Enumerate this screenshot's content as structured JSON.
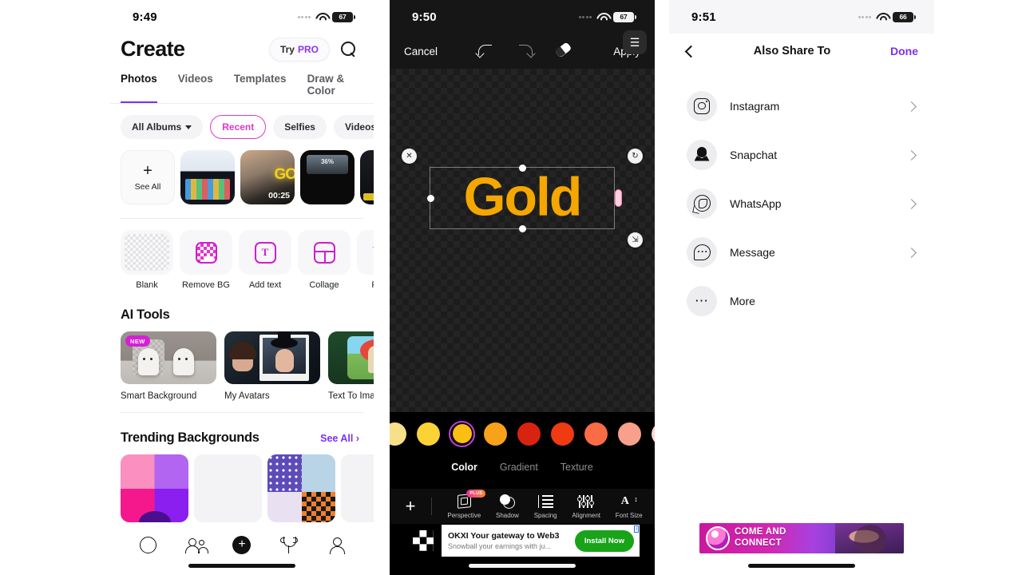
{
  "panel_create": {
    "status": {
      "time": "9:49",
      "battery": "67",
      "wifi_icon": "wifi-icon",
      "signal_icon": "signal-dots-icon"
    },
    "header": {
      "title": "Create",
      "try_pro_prefix": "Try",
      "try_pro_highlight": "PRO",
      "search_icon": "search-icon"
    },
    "tabs": [
      {
        "label": "Photos",
        "active": true
      },
      {
        "label": "Videos",
        "active": false
      },
      {
        "label": "Templates",
        "active": false
      },
      {
        "label": "Draw & Color",
        "active": false
      }
    ],
    "chips": [
      {
        "label": "All Albums",
        "selected": false,
        "has_caret": true
      },
      {
        "label": "Recent",
        "selected": true,
        "has_caret": false
      },
      {
        "label": "Selfies",
        "selected": false,
        "has_caret": false
      },
      {
        "label": "Videos",
        "selected": false,
        "has_caret": false
      }
    ],
    "see_all_tile": {
      "label": "See All",
      "icon": "plus-icon"
    },
    "thumbnails": [
      {
        "name": "screen-recording-thumb",
        "duration": ""
      },
      {
        "name": "skateboard-video-thumb",
        "duration": "00:25",
        "overlay_text": "GO"
      },
      {
        "name": "dark-export-thumb",
        "percent": "36%"
      },
      {
        "name": "timeline-thumb",
        "duration": ""
      }
    ],
    "quick_tools": [
      {
        "label": "Blank",
        "icon": "transparent-checker-icon"
      },
      {
        "label": "Remove BG",
        "icon": "remove-background-icon"
      },
      {
        "label": "Add text",
        "icon": "text-box-icon"
      },
      {
        "label": "Collage",
        "icon": "collage-grid-icon"
      },
      {
        "label": "Remo",
        "icon": "magic-wand-icon"
      }
    ],
    "ai_tools": {
      "title": "AI Tools",
      "cards": [
        {
          "label": "Smart Background",
          "badge": "NEW",
          "art": "ghost-photo"
        },
        {
          "label": "My Avatars",
          "badge": "",
          "art": "avatar-portraits"
        },
        {
          "label": "Text To Imag",
          "badge": "",
          "art": "text-to-image-art"
        }
      ]
    },
    "trending": {
      "title": "Trending Backgrounds",
      "see_all": "See All",
      "see_all_chevron": "chevron-right-icon",
      "items": [
        "pink-purple-gradient",
        "blank-light",
        "halloween-pattern",
        "light-tile"
      ]
    },
    "tabbar": [
      {
        "name": "discover",
        "icon": "compass-icon"
      },
      {
        "name": "community",
        "icon": "people-icon"
      },
      {
        "name": "create",
        "icon": "plus-circle-icon"
      },
      {
        "name": "challenges",
        "icon": "trophy-icon"
      },
      {
        "name": "profile",
        "icon": "person-icon"
      }
    ]
  },
  "panel_editor": {
    "status": {
      "time": "9:50",
      "battery": "67"
    },
    "topbar": {
      "cancel": "Cancel",
      "apply": "Apply",
      "undo_icon": "undo-icon",
      "redo_icon": "redo-icon",
      "eraser_icon": "eraser-icon"
    },
    "layers_icon": "layers-icon",
    "canvas": {
      "text_value": "Gold",
      "text_color": "#F5A700",
      "delete_icon": "close-icon",
      "rotate_icon": "rotate-icon",
      "resize_icon": "resize-icon",
      "edit_handle": "edit-pill-handle"
    },
    "swatches": [
      {
        "color": "#F6E08A",
        "selected": false
      },
      {
        "color": "#FBD335",
        "selected": false
      },
      {
        "color": "#FBBF14",
        "selected": true
      },
      {
        "color": "#F8A21A",
        "selected": false
      },
      {
        "color": "#D7230F",
        "selected": false
      },
      {
        "color": "#F03A11",
        "selected": false
      },
      {
        "color": "#F96C45",
        "selected": false
      },
      {
        "color": "#F8A08B",
        "selected": false
      },
      {
        "color": "#FAD9CF",
        "selected": false
      }
    ],
    "modes": [
      {
        "label": "Color",
        "active": true
      },
      {
        "label": "Gradient",
        "active": false
      },
      {
        "label": "Texture",
        "active": false
      }
    ],
    "toolbar": {
      "add_icon": "plus-icon",
      "items": [
        {
          "label": "Perspective",
          "icon": "cube-icon",
          "badge": "PLUS"
        },
        {
          "label": "Shadow",
          "icon": "shadow-icon",
          "badge": ""
        },
        {
          "label": "Spacing",
          "icon": "line-spacing-icon",
          "badge": ""
        },
        {
          "label": "Alignment",
          "icon": "alignment-sliders-icon",
          "badge": ""
        },
        {
          "label": "Font Size",
          "icon": "font-size-icon",
          "badge": ""
        }
      ]
    },
    "ad": {
      "headline": "OKXI Your gateway to Web3",
      "subline": "Snowball your earnings with ju...",
      "cta": "Install Now",
      "ad_marker": "i",
      "logo_icon": "okx-logo-icon"
    }
  },
  "panel_share": {
    "status": {
      "time": "9:51",
      "battery": "66"
    },
    "nav": {
      "back_icon": "chevron-left-icon",
      "title": "Also Share To",
      "done": "Done"
    },
    "rows": [
      {
        "label": "Instagram",
        "icon": "instagram-icon",
        "chevron": true
      },
      {
        "label": "Snapchat",
        "icon": "snapchat-icon",
        "chevron": true
      },
      {
        "label": "WhatsApp",
        "icon": "whatsapp-icon",
        "chevron": true
      },
      {
        "label": "Message",
        "icon": "message-icon",
        "chevron": true
      },
      {
        "label": "More",
        "icon": "more-dots-icon",
        "chevron": false
      }
    ],
    "ad": {
      "line1": "COME AND",
      "line1_highlight": "AND",
      "line2": "CONNECT"
    }
  }
}
